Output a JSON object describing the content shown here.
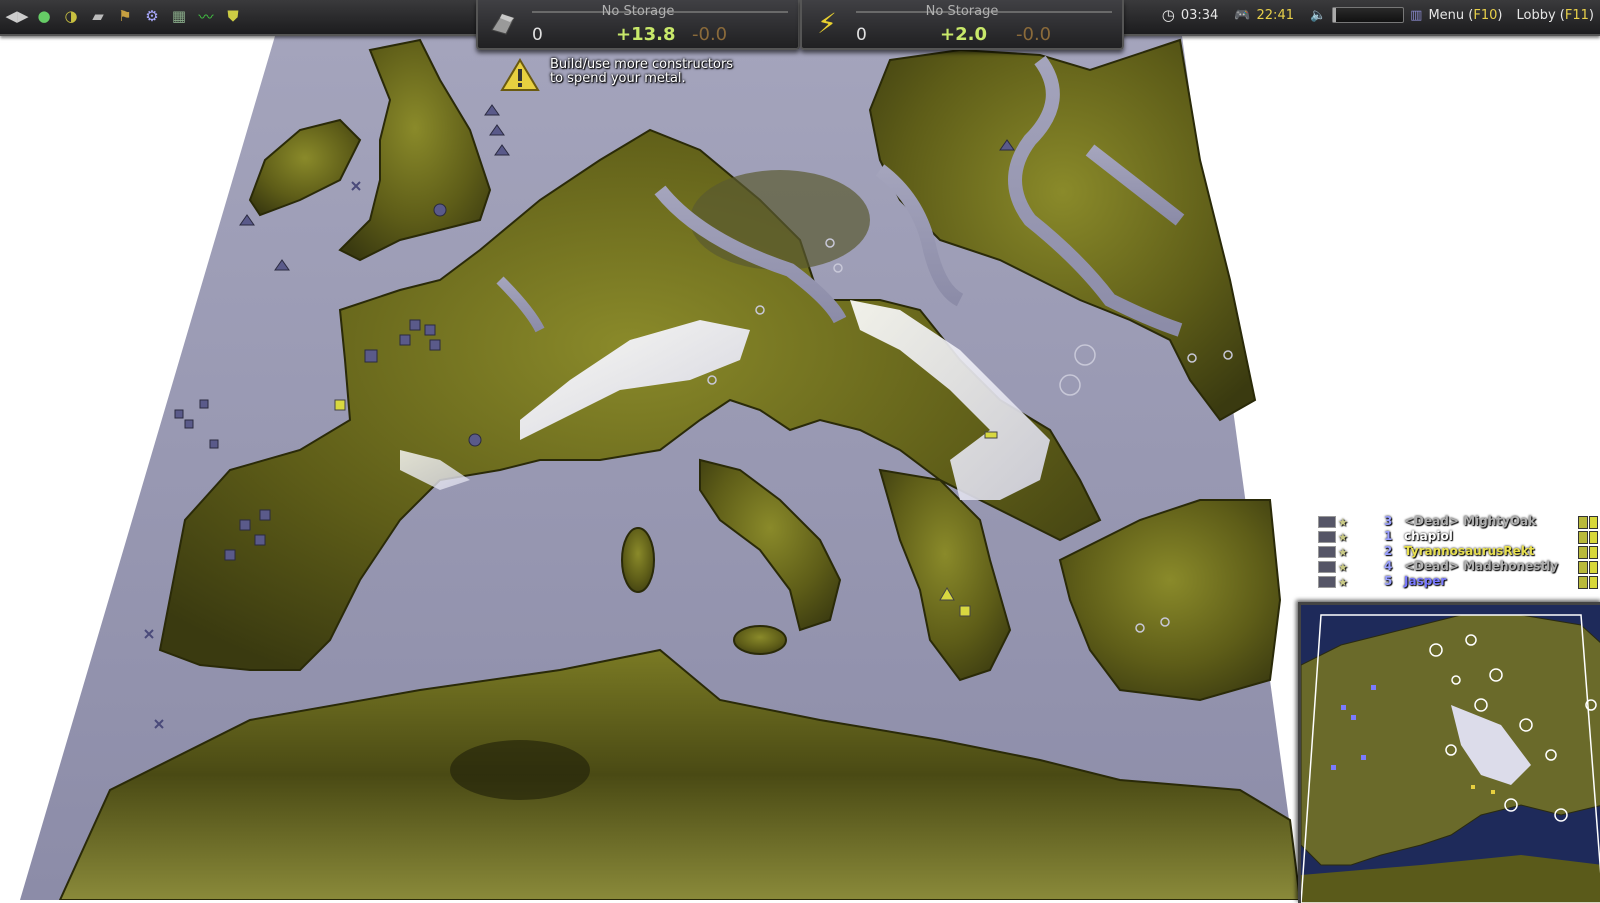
{
  "topbar": {
    "icons": [
      "play-pause-icon",
      "green-orb-icon",
      "chart-orb-icon",
      "eraser-icon",
      "flag-icon",
      "settings-cog-icon",
      "factory-icon",
      "graph-icon",
      "shield-icon"
    ],
    "metal": {
      "storage_label": "No Storage",
      "current": "0",
      "income": "+13.8",
      "expense": "-0.0"
    },
    "energy": {
      "storage_label": "No Storage",
      "current": "0",
      "income": "+2.0",
      "expense": "-0.0"
    },
    "clock": "03:34",
    "fps": "22:41",
    "menu_label": "Menu",
    "menu_key": "F10",
    "lobby_label": "Lobby",
    "lobby_key": "F11"
  },
  "warning": {
    "line1": "Build/use more constructors",
    "line2": "to spend your metal."
  },
  "players": [
    {
      "id": "3",
      "name": "<Dead> MightyOak",
      "color": "#b0b0b0"
    },
    {
      "id": "1",
      "name": "chapiol",
      "color": "#ffffff"
    },
    {
      "id": "2",
      "name": "TyrannosaurusRekt",
      "color": "#e8e050"
    },
    {
      "id": "4",
      "name": "<Dead> Madehonestly",
      "color": "#b0b0b0"
    },
    {
      "id": "5",
      "name": "Jasper",
      "color": "#7a7aff"
    }
  ],
  "colors": {
    "water": "#9898b2",
    "land": "#6b6a1c",
    "accent": "#e8d04a"
  }
}
